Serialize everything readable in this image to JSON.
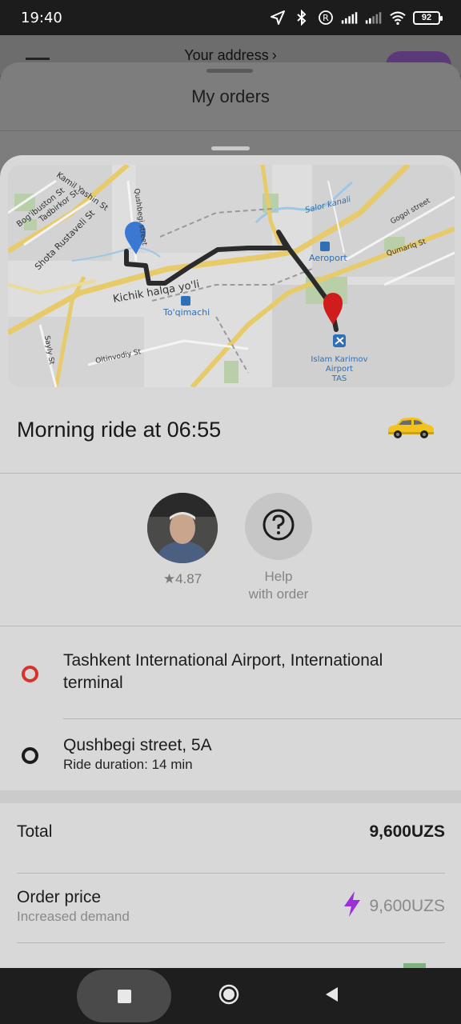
{
  "status_bar": {
    "time": "19:40",
    "battery": "92"
  },
  "background": {
    "address_label": "Your address",
    "orders_title": "My orders"
  },
  "map": {
    "labels": {
      "bogibuston": "Bog'ibuston St",
      "tadbirkor": "Tadbirkor St",
      "shota": "Shota Rustaveli St",
      "yashin": "Kamil Yashin St",
      "qushbegi": "Qushbegi street",
      "kichik": "Kichik halqa yo'li",
      "toqimachi": "To'qimachi",
      "oltinvodiy": "Oltinvodiy St",
      "salor": "Salor kanali",
      "aeroport": "Aeroport",
      "gogol": "Gogol street",
      "qumariq": "Qumariq St",
      "airport_line1": "Islam Karimov",
      "airport_line2": "Airport",
      "airport_line3": "TAS",
      "sayly": "Sayly St"
    }
  },
  "ride": {
    "title": "Morning ride at 06:55",
    "car_icon": "taxi-car-icon"
  },
  "driver": {
    "rating": "★4.87",
    "help_line1": "Help",
    "help_line2": "with order"
  },
  "route": {
    "pickup": "Tashkent International Airport, International terminal",
    "dropoff": "Qushbegi street, 5A",
    "duration": "Ride duration: 14 min"
  },
  "payment": {
    "total_label": "Total",
    "total_value": "9,600UZS",
    "price_label": "Order price",
    "price_sub": "Increased demand",
    "price_value": "9,600UZS"
  },
  "colors": {
    "accent_red": "#d8322a",
    "surge_purple": "#9b30d9",
    "route_line": "#2b2b2b",
    "pin_blue": "#3a78d4",
    "pin_red": "#cf1c1c"
  }
}
